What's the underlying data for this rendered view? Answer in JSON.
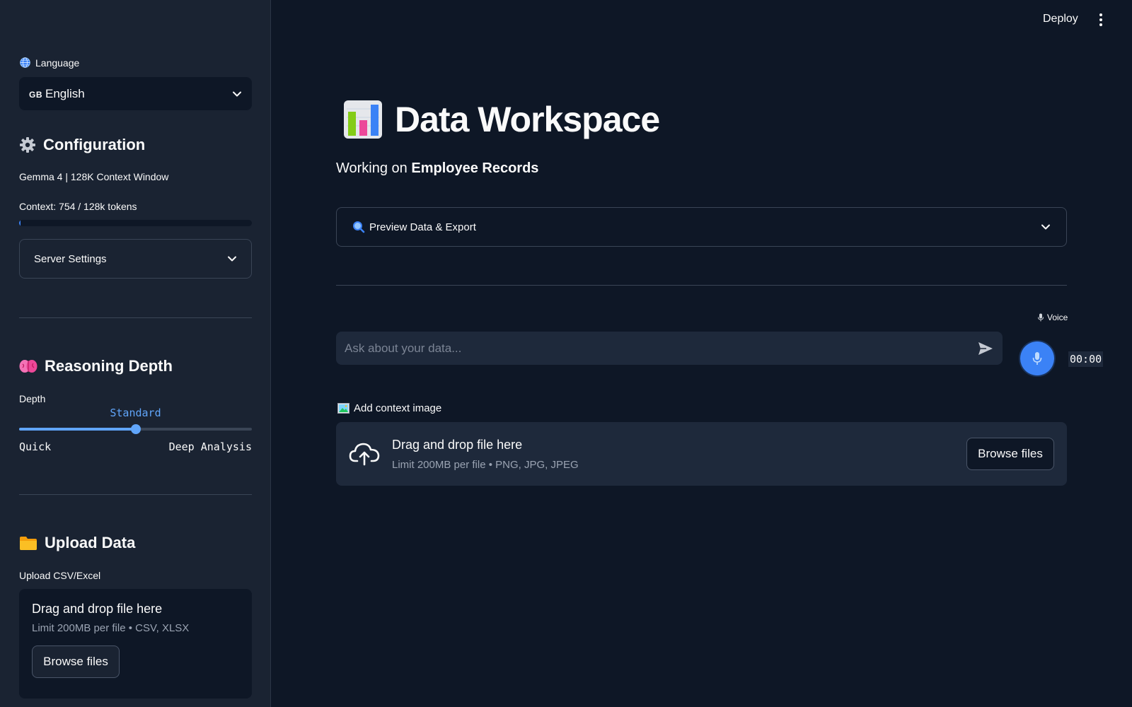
{
  "header": {
    "deploy_label": "Deploy",
    "menu_icon": "more-vertical-icon"
  },
  "sidebar": {
    "language": {
      "label": "Language",
      "icon": "globe-icon",
      "flag": "GB",
      "selected": "English"
    },
    "configuration": {
      "title": "Configuration",
      "icon": "gear-icon",
      "model_info": "Gemma 4 | 128K Context Window",
      "context_text": "Context: 754 / 128k tokens",
      "context_progress": 0.0059
    },
    "server_settings": {
      "label": "Server Settings"
    },
    "reasoning": {
      "title": "Reasoning Depth",
      "icon": "brain-icon",
      "slider_label": "Depth",
      "value": "Standard",
      "value_position": 0.5,
      "min_label": "Quick",
      "max_label": "Deep Analysis"
    },
    "upload": {
      "title": "Upload Data",
      "icon": "folder-icon",
      "field_label": "Upload CSV/Excel",
      "drop_text": "Drag and drop file here",
      "limit_text": "Limit 200MB per file • CSV, XLSX",
      "browse_label": "Browse files"
    }
  },
  "main": {
    "title": "Data Workspace",
    "title_icon": "bar-chart-icon",
    "subtitle_prefix": "Working on",
    "subtitle_dataset": "Employee Records",
    "preview_expander": {
      "icon": "magnifier-icon",
      "label": "Preview Data & Export"
    },
    "voice": {
      "label": "Voice",
      "timer": "00:00"
    },
    "chat": {
      "placeholder": "Ask about your data..."
    },
    "context_image": {
      "label": "Add context image",
      "drop_text": "Drag and drop file here",
      "limit_text": "Limit 200MB per file • PNG, JPG, JPEG",
      "browse_label": "Browse files"
    }
  },
  "colors": {
    "background": "#0e1726",
    "sidebar": "#1a2332",
    "accent": "#3b82f6",
    "slider": "#60a5fa"
  }
}
